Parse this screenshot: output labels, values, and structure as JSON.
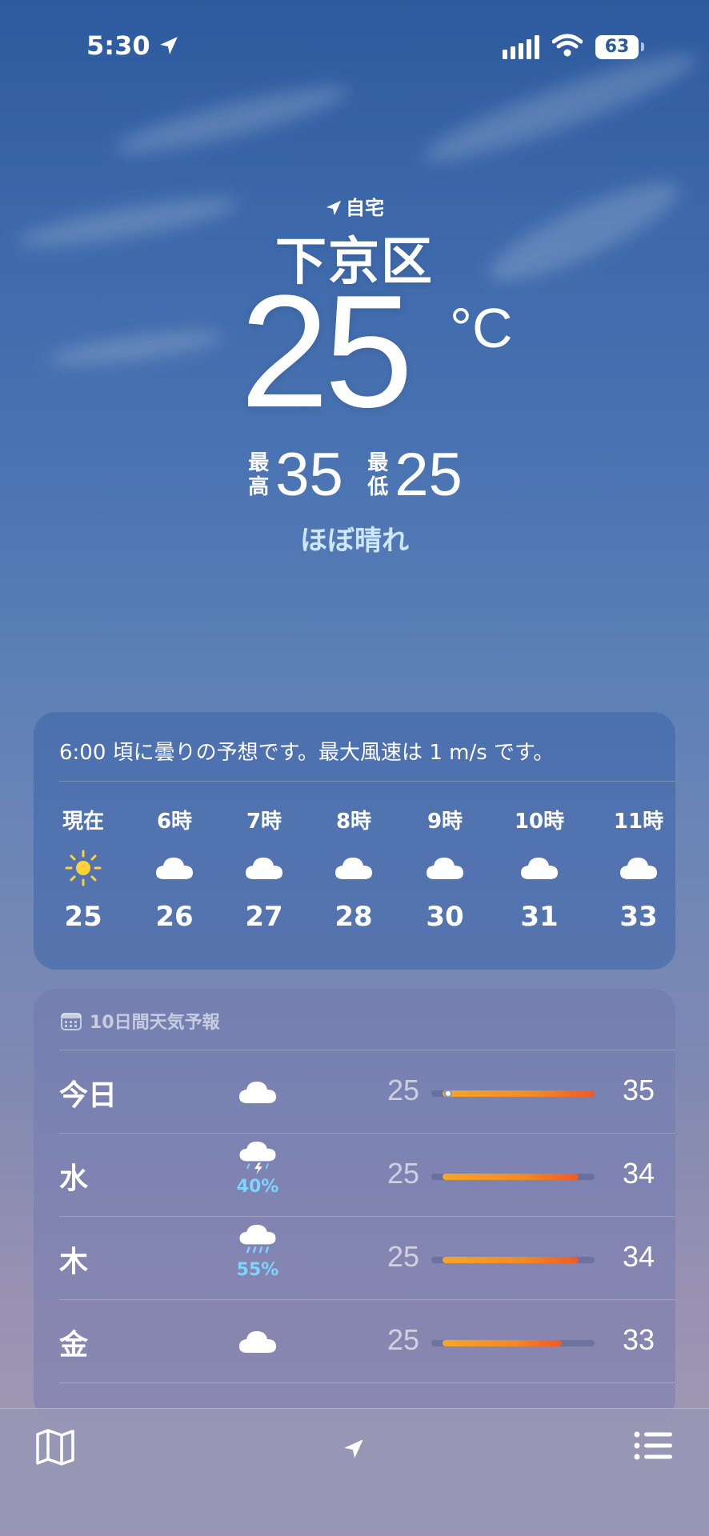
{
  "status_bar": {
    "time": "5:30",
    "battery": "63"
  },
  "hero": {
    "location_label": "自宅",
    "city": "下京区",
    "temperature": "25",
    "unit": "°C",
    "high_label": "最高",
    "high": "35",
    "low_label": "最低",
    "low": "25",
    "condition": "ほぼ晴れ"
  },
  "hourly": {
    "summary": "6:00 頃に曇りの予想です。最大風速は 1 m/s です。",
    "items": [
      {
        "label": "現在",
        "icon": "sun-icon",
        "temp": "25"
      },
      {
        "label": "6時",
        "icon": "cloud-icon",
        "temp": "26"
      },
      {
        "label": "7時",
        "icon": "cloud-icon",
        "temp": "27"
      },
      {
        "label": "8時",
        "icon": "cloud-icon",
        "temp": "28"
      },
      {
        "label": "9時",
        "icon": "cloud-icon",
        "temp": "30"
      },
      {
        "label": "10時",
        "icon": "cloud-icon",
        "temp": "31"
      },
      {
        "label": "11時",
        "icon": "cloud-icon",
        "temp": "33"
      }
    ]
  },
  "daily": {
    "header": "10日間天気予報",
    "range_min": 25,
    "range_max": 35,
    "days": [
      {
        "day": "今日",
        "icon": "cloud-icon",
        "precip": "",
        "low": "25",
        "high": "35",
        "current": 25
      },
      {
        "day": "水",
        "icon": "thunderstorm-icon",
        "precip": "40%",
        "low": "25",
        "high": "34"
      },
      {
        "day": "木",
        "icon": "rain-icon",
        "precip": "55%",
        "low": "25",
        "high": "34"
      },
      {
        "day": "金",
        "icon": "cloud-icon",
        "precip": "",
        "low": "25",
        "high": "33"
      }
    ]
  },
  "colors": {
    "sky_top": "#2d5a9e",
    "sky_bottom": "#a89cb6",
    "precip": "#7cd4ff",
    "sun": "#ffd23a"
  }
}
